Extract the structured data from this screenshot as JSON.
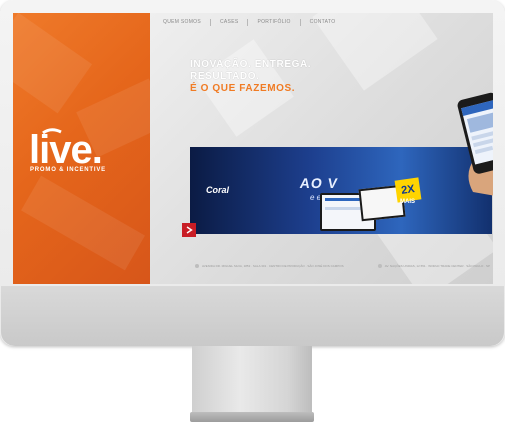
{
  "nav": {
    "items": [
      "QUEM SOMOS",
      "CASES",
      "PORTIFÓLIO",
      "CONTATO"
    ]
  },
  "brand": {
    "logo_text": "live.",
    "tagline": "PROMO & INCENTIVE",
    "accent_color": "#ef7a2a"
  },
  "hero": {
    "line1": "INOVAÇÃO. ENTREGA.",
    "line2": "RESULTADO.",
    "line3": "É O QUE FAZEMOS."
  },
  "banner": {
    "brand_name": "Coral",
    "headline_fragment": "AO V",
    "sub_fragment": "e em",
    "promo_number": "2X",
    "promo_sub": "MAIS"
  },
  "footer": {
    "address1": "AVENIDA DR. MIGUEL SILVA, 1853 · SALA 301 · CENTRO DE PRODUÇÃO · SÃO JOSÉ DOS CAMPOS",
    "address2": "AV. NAÇÕES UNIDAS, 12.551 · WORLD TRADE CENTER · SÃO PAULO · SP"
  },
  "icons": [
    "play-icon",
    "location-pin-icon",
    "phone-icon"
  ]
}
